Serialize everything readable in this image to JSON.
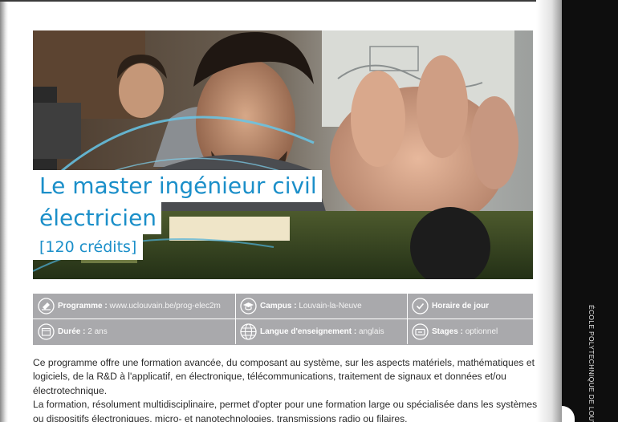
{
  "title": {
    "line1": "Le master ingénieur civil",
    "line2": "électricien",
    "credits": "[120 crédits]"
  },
  "info": {
    "programme_label": "Programme :",
    "programme_value": "www.uclouvain.be/prog-elec2m",
    "campus_label": "Campus :",
    "campus_value": "Louvain-la-Neuve",
    "horaire_label": "Horaire de jour",
    "duree_label": "Durée :",
    "duree_value": "2 ans",
    "langue_label": "Langue d'enseignement :",
    "langue_value": "anglais",
    "stages_label": "Stages :",
    "stages_value": "optionnel"
  },
  "icons": [
    "laptop-icon",
    "graduation-cap-icon",
    "clock-icon",
    "calendar-icon",
    "globe-icon",
    "briefcase-icon"
  ],
  "body": {
    "paragraph1": "Ce programme offre une formation avancée, du composant au système, sur les aspects matériels, mathématiques et logiciels, de la R&D à l'applicatif, en électronique, télécommunications, traitement de signaux et données et/ou électrotechnique.",
    "paragraph2": "La formation, résolument multidisciplinaire, permet d'opter pour une formation large ou spécialisée dans les systèmes ou dispositifs électroniques, micro- et nanotechnologies, transmissions radio ou filaires,"
  },
  "side_label": "ÉCOLE POLYTECHNIQUE DE LOUVAIN",
  "colors": {
    "title_blue": "#1b8fc9",
    "info_bar_gray": "#a9a9ac",
    "side_band": "#0e0e0e"
  }
}
